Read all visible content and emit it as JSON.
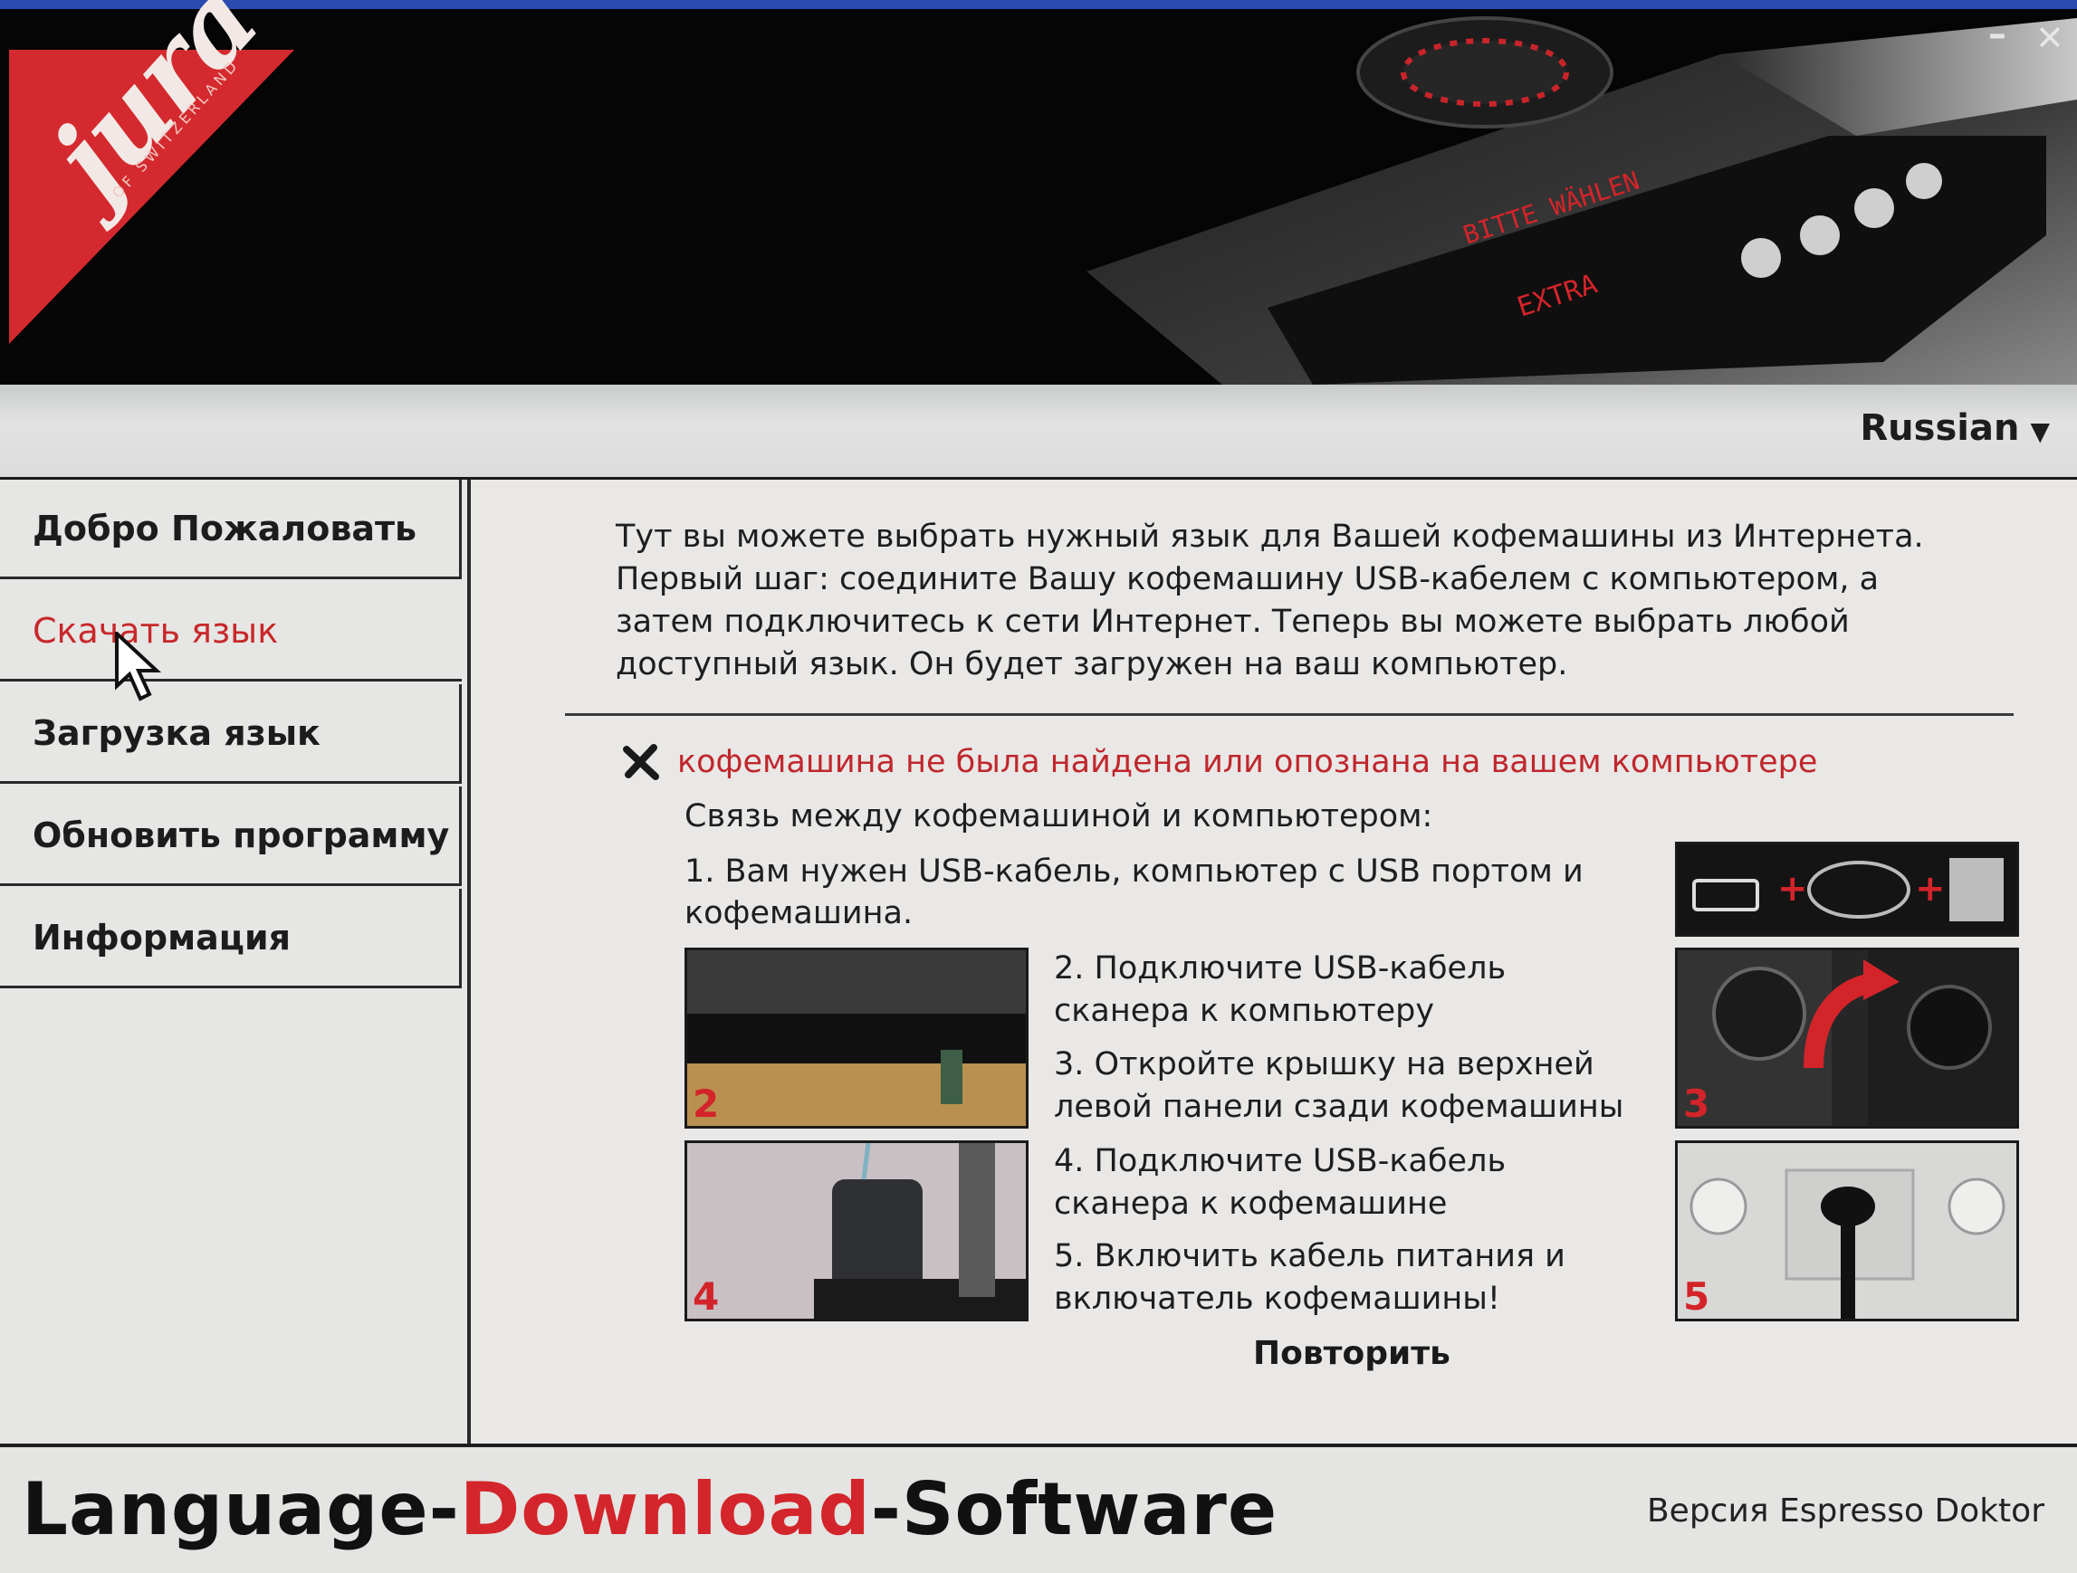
{
  "window": {
    "minimize_label": "–",
    "close_label": "✕"
  },
  "header": {
    "logo_text": "jura",
    "logo_subtext": "OF SWITZERLAND",
    "machine_display_text": "BITTE WÄHLEN",
    "machine_display_text2": "EXTRA",
    "language_selected": "Russian"
  },
  "sidebar": {
    "items": [
      {
        "label": "Добро Пожаловать"
      },
      {
        "label": "Скачать язык"
      },
      {
        "label": "Загрузка язык"
      },
      {
        "label": "Обновить программу"
      },
      {
        "label": "Информация"
      }
    ]
  },
  "main": {
    "intro_lines": [
      "Тут вы можете выбрать нужный язык для Вашей кофемашины из Интернета.",
      "Первый шаг: соедините Вашу кофемашину USB-кабелем с компьютером, а",
      "затем подключитесь к сети Интернет. Теперь вы можете выбрать любой",
      "доступный язык. Он будет загружен на ваш компьютер."
    ],
    "error_message": "кофемашина не была найдена или опознана на вашем компьютере",
    "connection_title": "Связь между кофемашиной и компьютером:",
    "step1": [
      "1. Вам нужен USB-кабель, компьютер с USB портом и",
      "кофемашина."
    ],
    "step2": [
      "2. Подключите USB-кабель",
      "сканера к компьютеру"
    ],
    "step3": [
      "3. Откройте крышку на верхней",
      "левой панели сзади  кофемашины"
    ],
    "step4": [
      "4. Подключите USB-кабель",
      "сканера к кофемашине"
    ],
    "step5": [
      "5. Включить кабель питания и",
      "включатель кофемашины!"
    ],
    "photo_numbers": {
      "p2": "2",
      "p3": "3",
      "p4": "4",
      "p5": "5"
    },
    "retry_label": "Повторить"
  },
  "footer": {
    "brand_part1": "Language-",
    "brand_part2": "Download",
    "brand_part3": "-Software",
    "version": "Версия Espresso Doktor"
  },
  "colors": {
    "accent_red": "#c8282b",
    "banner_bg": "#050505"
  }
}
